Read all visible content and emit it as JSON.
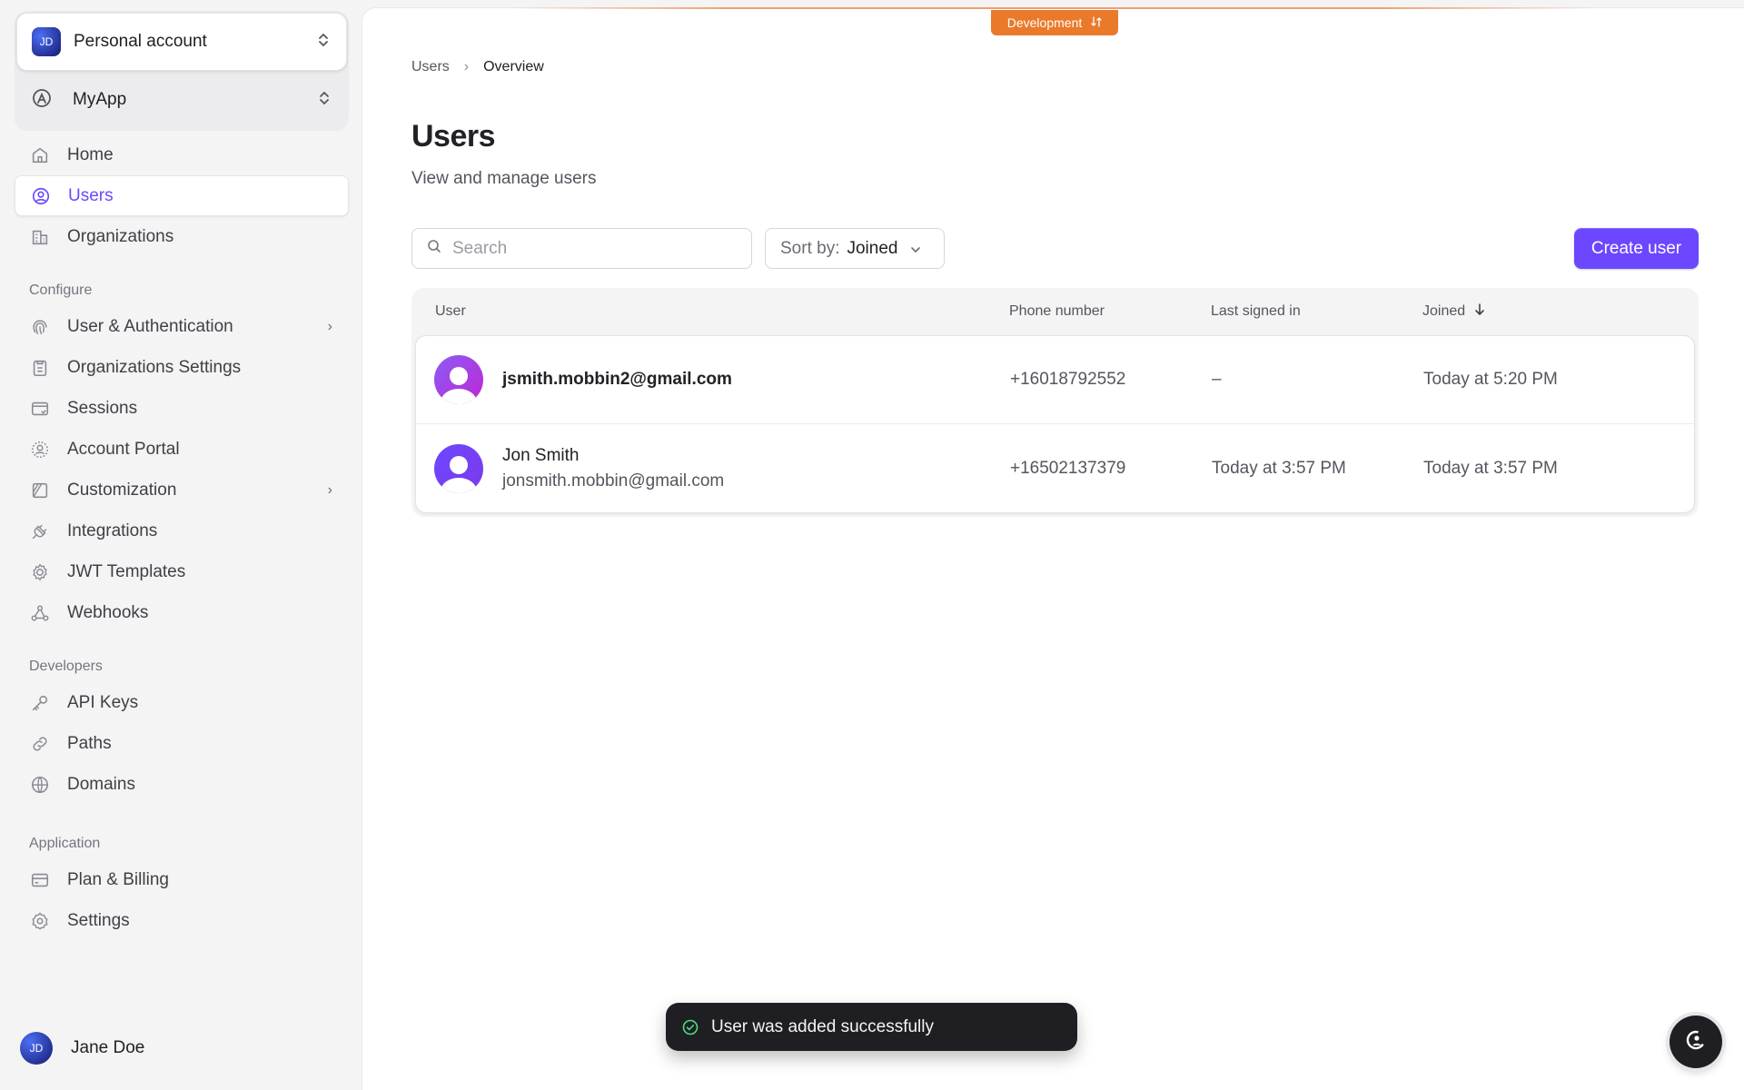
{
  "sidebar": {
    "account": {
      "avatar_initials": "JD",
      "label": "Personal account"
    },
    "app": {
      "label": "MyApp"
    },
    "nav": [
      {
        "label": "Home",
        "icon": "home-icon"
      },
      {
        "label": "Users",
        "icon": "user-circle-icon",
        "active": true
      },
      {
        "label": "Organizations",
        "icon": "building-icon"
      }
    ],
    "sections": [
      {
        "title": "Configure",
        "items": [
          {
            "label": "User & Authentication",
            "icon": "fingerprint-icon",
            "chevron": true
          },
          {
            "label": "Organizations Settings",
            "icon": "clipboard-icon"
          },
          {
            "label": "Sessions",
            "icon": "sessions-icon"
          },
          {
            "label": "Account Portal",
            "icon": "portal-icon"
          },
          {
            "label": "Customization",
            "icon": "palette-icon",
            "chevron": true
          },
          {
            "label": "Integrations",
            "icon": "plug-icon"
          },
          {
            "label": "JWT Templates",
            "icon": "gear-badge-icon"
          },
          {
            "label": "Webhooks",
            "icon": "webhook-icon"
          }
        ]
      },
      {
        "title": "Developers",
        "items": [
          {
            "label": "API Keys",
            "icon": "key-icon"
          },
          {
            "label": "Paths",
            "icon": "link-icon"
          },
          {
            "label": "Domains",
            "icon": "globe-icon"
          }
        ]
      },
      {
        "title": "Application",
        "items": [
          {
            "label": "Plan & Billing",
            "icon": "credit-card-icon"
          },
          {
            "label": "Settings",
            "icon": "gear-icon"
          }
        ]
      }
    ],
    "user": {
      "avatar_initials": "JD",
      "name": "Jane Doe"
    }
  },
  "env_badge": {
    "label": "Development"
  },
  "breadcrumb": {
    "parent": "Users",
    "current": "Overview"
  },
  "page": {
    "title": "Users",
    "subtitle": "View and manage users"
  },
  "toolbar": {
    "search_placeholder": "Search",
    "sort_label": "Sort by:",
    "sort_value": "Joined",
    "create_label": "Create user"
  },
  "table": {
    "headers": {
      "user": "User",
      "phone": "Phone number",
      "last": "Last signed in",
      "joined": "Joined"
    },
    "rows": [
      {
        "primary": "jsmith.mobbin2@gmail.com",
        "secondary": "",
        "phone": "+16018792552",
        "last": "–",
        "joined": "Today at 5:20 PM"
      },
      {
        "primary": "Jon Smith",
        "secondary": "jonsmith.mobbin@gmail.com",
        "phone": "+16502137379",
        "last": "Today at 3:57 PM",
        "joined": "Today at 3:57 PM"
      }
    ]
  },
  "toast": {
    "message": "User was added successfully"
  },
  "colors": {
    "accent": "#6c47ff",
    "dev_badge": "#ea7a2a",
    "toast_bg": "#1f1f23"
  }
}
